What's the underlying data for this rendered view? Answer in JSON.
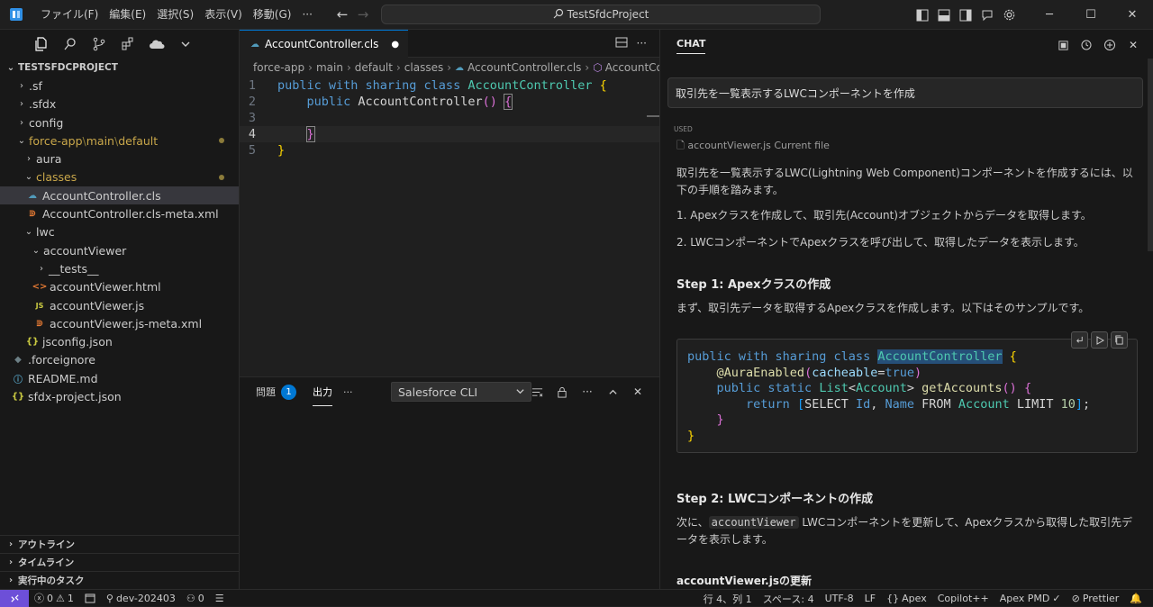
{
  "titlebar": {
    "menus": [
      "ファイル(F)",
      "編集(E)",
      "選択(S)",
      "表示(V)",
      "移動(G)",
      "···"
    ],
    "search": "TestSfdcProject"
  },
  "explorer": {
    "root": "TESTSFDCPROJECT",
    "items": [
      {
        "label": ".sf"
      },
      {
        "label": ".sfdx"
      },
      {
        "label": "config"
      },
      {
        "label": "force-app",
        "path2": "main",
        "path3": "default"
      },
      {
        "label": "aura"
      },
      {
        "label": "classes"
      },
      {
        "label": "AccountController.cls"
      },
      {
        "label": "AccountController.cls-meta.xml"
      },
      {
        "label": "lwc"
      },
      {
        "label": "accountViewer"
      },
      {
        "label": "__tests__"
      },
      {
        "label": "accountViewer.html"
      },
      {
        "label": "accountViewer.js"
      },
      {
        "label": "accountViewer.js-meta.xml"
      },
      {
        "label": "jsconfig.json"
      },
      {
        "label": ".forceignore"
      },
      {
        "label": "README.md"
      },
      {
        "label": "sfdx-project.json"
      }
    ],
    "sections": [
      "アウトライン",
      "タイムライン",
      "実行中のタスク"
    ]
  },
  "editor": {
    "tab": "AccountController.cls",
    "breadcrumb": [
      "force-app",
      "main",
      "default",
      "classes",
      "AccountController.cls",
      "AccountContro"
    ],
    "line_numbers": [
      "1",
      "2",
      "3",
      "4",
      "5"
    ]
  },
  "panel": {
    "problems": "問題",
    "problems_count": "1",
    "output": "出力",
    "more": "···",
    "channel": "Salesforce CLI"
  },
  "chat": {
    "title": "CHAT",
    "prompt": "取引先を一覧表示するLWCコンポーネントを作成",
    "used_label": "USED",
    "used_file": "accountViewer.js",
    "used_file_note": "Current file",
    "intro": "取引先を一覧表示するLWC(Lightning Web Component)コンポーネントを作成するには、以下の手順を踏みます。",
    "step_list_1": "1. Apexクラスを作成して、取引先(Account)オブジェクトからデータを取得します。",
    "step_list_2": "2. LWCコンポーネントでApexクラスを呼び出して、取得したデータを表示します。",
    "step1_heading": "Step 1: Apexクラスの作成",
    "step1_text": "まず、取引先データを取得するApexクラスを作成します。以下はそのサンプルです。",
    "step2_heading": "Step 2: LWCコンポーネントの作成",
    "step2_pre": "次に、",
    "step2_code": "accountViewer",
    "step2_post": " LWCコンポーネントを更新して、Apexクラスから取得した取引先データを表示します。",
    "sub_heading": "accountViewer.jsの更新"
  },
  "statusbar": {
    "errors": "0",
    "warnings": "1",
    "branch": "dev-202403",
    "ports": "0",
    "position": "行 4、列 1",
    "spaces": "スペース: 4",
    "encoding": "UTF-8",
    "eol": "LF",
    "language": "Apex",
    "copilot": "Copilot++",
    "pmd": "Apex PMD",
    "prettier": "Prettier"
  },
  "colors": {
    "accent": "#0078d4",
    "remote": "#6d4fd8",
    "modified": "#c9a74a"
  }
}
